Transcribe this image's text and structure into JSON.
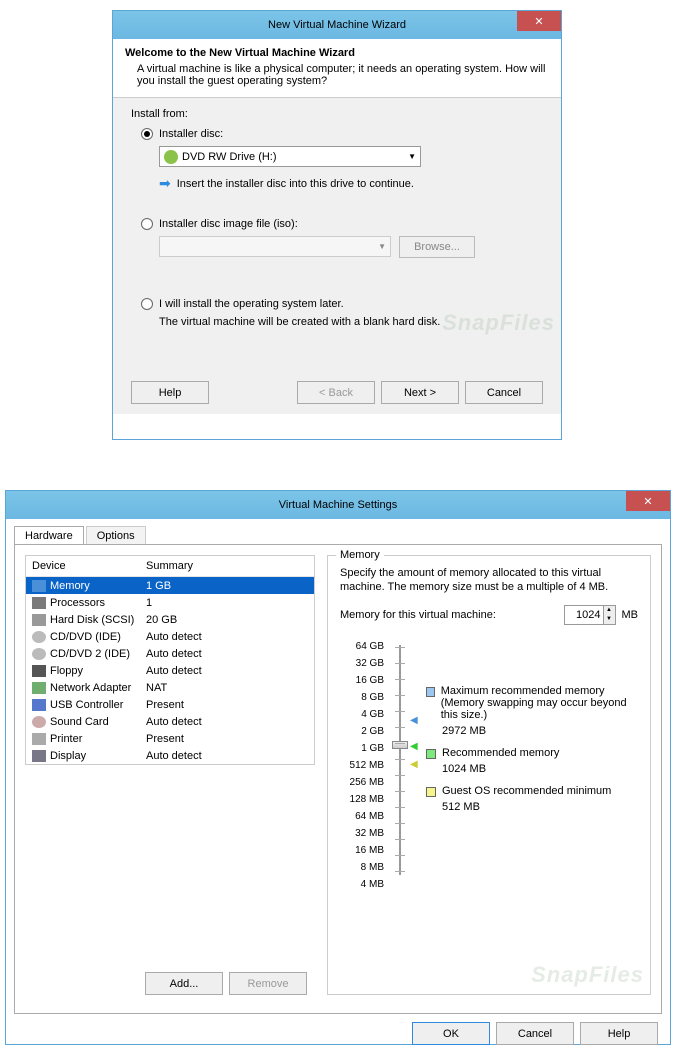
{
  "wizard": {
    "title": "New Virtual Machine Wizard",
    "heading": "Welcome to the New Virtual Machine Wizard",
    "subheading": "A virtual machine is like a physical computer; it needs an operating system. How will you install the guest operating system?",
    "install_from_label": "Install from:",
    "radio_disc": "Installer disc:",
    "disc_value": "DVD RW Drive (H:)",
    "disc_hint": "Insert the installer disc into this drive to continue.",
    "radio_iso": "Installer disc image file (iso):",
    "browse_label": "Browse...",
    "radio_later": "I will install the operating system later.",
    "later_hint": "The virtual machine will be created with a blank hard disk.",
    "help_label": "Help",
    "back_label": "< Back",
    "next_label": "Next >",
    "cancel_label": "Cancel"
  },
  "settings": {
    "title": "Virtual Machine Settings",
    "tab_hardware": "Hardware",
    "tab_options": "Options",
    "col_device": "Device",
    "col_summary": "Summary",
    "devices": [
      {
        "name": "Memory",
        "summary": "1 GB"
      },
      {
        "name": "Processors",
        "summary": "1"
      },
      {
        "name": "Hard Disk (SCSI)",
        "summary": "20 GB"
      },
      {
        "name": "CD/DVD (IDE)",
        "summary": "Auto detect"
      },
      {
        "name": "CD/DVD 2 (IDE)",
        "summary": "Auto detect"
      },
      {
        "name": "Floppy",
        "summary": "Auto detect"
      },
      {
        "name": "Network Adapter",
        "summary": "NAT"
      },
      {
        "name": "USB Controller",
        "summary": "Present"
      },
      {
        "name": "Sound Card",
        "summary": "Auto detect"
      },
      {
        "name": "Printer",
        "summary": "Present"
      },
      {
        "name": "Display",
        "summary": "Auto detect"
      }
    ],
    "add_label": "Add...",
    "remove_label": "Remove",
    "memory_group": "Memory",
    "memory_desc": "Specify the amount of memory allocated to this virtual machine. The memory size must be a multiple of 4 MB.",
    "memory_label": "Memory for this virtual machine:",
    "memory_value": "1024",
    "memory_unit": "MB",
    "scale": [
      "64 GB",
      "32 GB",
      "16 GB",
      "8 GB",
      "4 GB",
      "2 GB",
      "1 GB",
      "512 MB",
      "256 MB",
      "128 MB",
      "64 MB",
      "32 MB",
      "16 MB",
      "8 MB",
      "4 MB"
    ],
    "legend_max": "Maximum recommended memory",
    "legend_max_note": "(Memory swapping may occur beyond this size.)",
    "legend_max_val": "2972 MB",
    "legend_rec": "Recommended memory",
    "legend_rec_val": "1024 MB",
    "legend_min": "Guest OS recommended minimum",
    "legend_min_val": "512 MB",
    "ok_label": "OK",
    "cancel_label": "Cancel",
    "help_label": "Help"
  },
  "watermark": "SnapFiles"
}
